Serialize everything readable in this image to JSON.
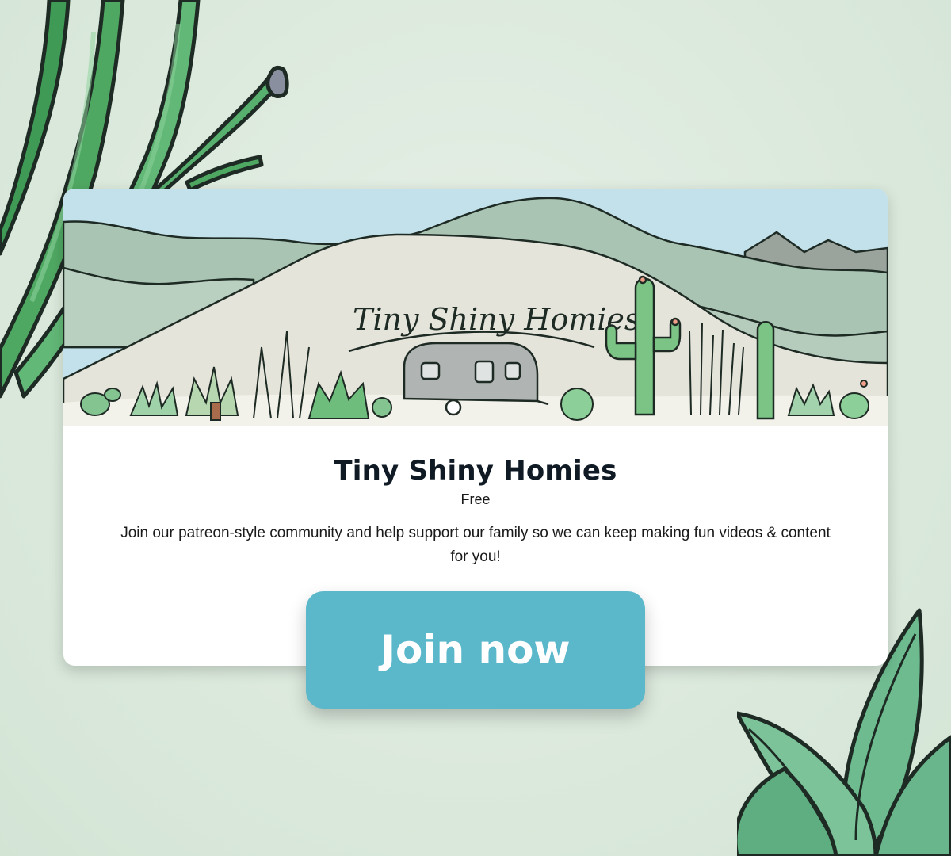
{
  "banner": {
    "lettering": "Tiny Shiny Homies"
  },
  "card": {
    "title": "Tiny Shiny Homies",
    "price": "Free",
    "description": "Join our patreon-style community and help support our family so we can keep making fun videos & content for you!",
    "cta_label": "Join now"
  },
  "icons": [
    "agave-leaves-decoration",
    "agave-rosette-decoration",
    "desert-landscape-illustration"
  ],
  "colors": {
    "background": "#dbe9dc",
    "card": "#ffffff",
    "button": "#5bb8cb",
    "button_text": "#ffffff",
    "title": "#0f1a24",
    "leaf_green": "#4fa862"
  }
}
